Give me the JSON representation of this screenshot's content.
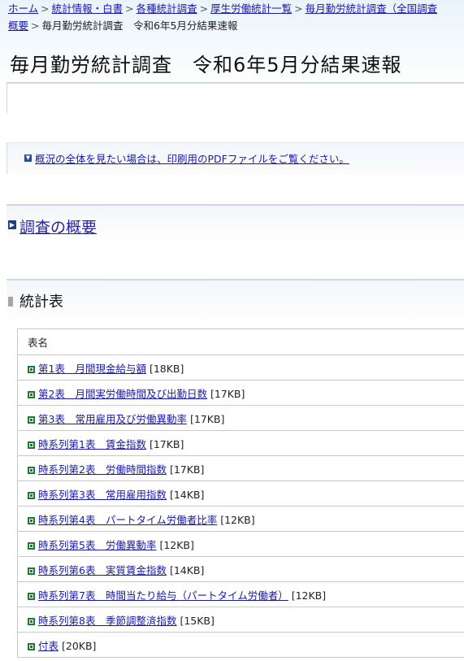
{
  "breadcrumb": {
    "items": [
      "ホーム",
      "統計情報・白書",
      "各種統計調査",
      "厚生労働統計一覧",
      "毎月勤労統計調査（全国調査"
    ],
    "item_last_line2": "概要",
    "separator": ">",
    "current": "毎月勤労統計調査　令和6年5月分結果速報"
  },
  "page": {
    "title": "毎月勤労統計調査　令和6年5月分結果速報"
  },
  "pdf_note": {
    "text": "概況の全体を見たい場合は、印刷用のPDFファイルをご覧ください。"
  },
  "outline": {
    "label": "調査の概要"
  },
  "stats": {
    "heading": "統計表",
    "column_header": "表名",
    "rows": [
      {
        "label": "第1表　月間現金給与額",
        "size": "[18KB]"
      },
      {
        "label": "第2表　月間実労働時間及び出勤日数",
        "size": "[17KB]"
      },
      {
        "label": "第3表　常用雇用及び労働異動率",
        "size": "[17KB]"
      },
      {
        "label": "時系列第1表　賃金指数",
        "size": "[17KB]"
      },
      {
        "label": "時系列第2表　労働時間指数",
        "size": "[17KB]"
      },
      {
        "label": "時系列第3表　常用雇用指数",
        "size": "[14KB]"
      },
      {
        "label": "時系列第4表　パートタイム労働者比率",
        "size": "[12KB]"
      },
      {
        "label": "時系列第5表　労働異動率",
        "size": "[12KB]"
      },
      {
        "label": "時系列第6表　実質賃金指数",
        "size": "[14KB]"
      },
      {
        "label": "時系列第7表　時間当たり給与（パートタイム労働者）",
        "size": "[12KB]"
      },
      {
        "label": "時系列第8表　季節調整済指数",
        "size": "[15KB]"
      },
      {
        "label": "付表",
        "size": "[20KB]"
      }
    ]
  },
  "colors": {
    "link": "#1a1aa6",
    "excel_icon": "#1e7a32",
    "nav_marker": "#1d3f85"
  }
}
